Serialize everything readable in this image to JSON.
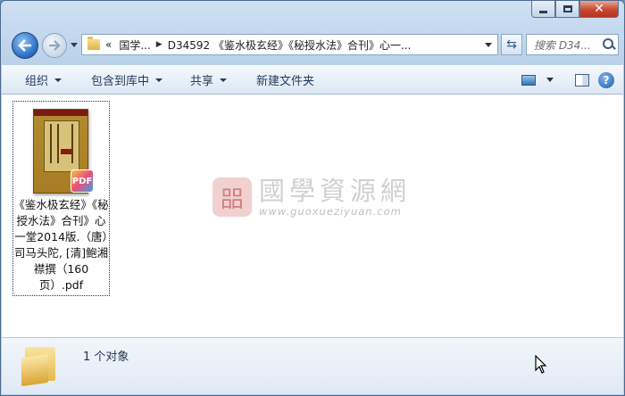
{
  "window": {
    "minimize_label": "minimize",
    "maximize_label": "maximize",
    "close_label": "close"
  },
  "nav": {
    "back_icon": "back-arrow-icon",
    "forward_icon": "forward-arrow-icon"
  },
  "address": {
    "overflow": "«",
    "crumb1": "国学...",
    "crumb2": "D34592 《鉴水极玄经》《秘授水法》合刊》心一..."
  },
  "search": {
    "placeholder": "搜索 D34..."
  },
  "toolbar": {
    "organize": "组织",
    "include_library": "包含到库中",
    "share": "共享",
    "new_folder": "新建文件夹"
  },
  "file": {
    "name": "《鉴水极玄经》《秘授水法》合刊》心一堂2014版.（唐）司马头陀, [清]鲍湘襟撰（160页）.pdf",
    "badge": "PDF"
  },
  "watermark": {
    "seal": "㗊",
    "title": "國學資源網",
    "url": "www.guoxueziyuan.com"
  },
  "details": {
    "count": "1 个对象"
  },
  "colors": {
    "accent": "#2f6fc4",
    "close": "#c8472e"
  }
}
